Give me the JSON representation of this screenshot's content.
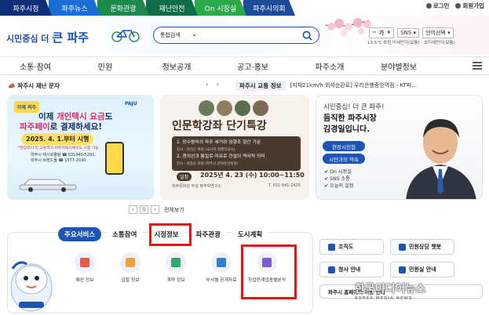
{
  "site_tabs": [
    {
      "label": "파주시청",
      "color": "#0e2f78"
    },
    {
      "label": "파주뉴스",
      "color": "#1a6fd6"
    },
    {
      "label": "문화관광",
      "color": "#1b8a4a"
    },
    {
      "label": "재난안전",
      "color": "#0f6e46"
    },
    {
      "label": "On 시장실",
      "color": "#2aa84a"
    },
    {
      "label": "파주시의회",
      "color": "#1d4b9c"
    }
  ],
  "top_util": {
    "login": "로그인",
    "join": "회원가입"
  },
  "logo": {
    "prefix": "시민중심 더",
    "name": "큰 파주"
  },
  "search": {
    "scope": "통합검색",
    "placeholder": ""
  },
  "util2": {
    "font_label": "가",
    "sns": "SNS",
    "lang": "언어선택"
  },
  "weather": "13.5℃ 흐림 미세먼지(보통) · 초미세먼지(보통)",
  "main_nav": [
    "소통·참여",
    "민원",
    "정보공개",
    "공고·홍보",
    "파주소개",
    "분야별정보"
  ],
  "alert": {
    "title": "파주시 재난 문자",
    "arrows": "‹ ›"
  },
  "traffic": {
    "badge": "파주시 교통 정보",
    "ticker": "[지체21km/h 외석순환로] 우리은행중앙역점 - KT파..."
  },
  "banner1": {
    "logo": "이제 파주",
    "title1_a": "이제 ",
    "title1_b": "개인택시 요금",
    "title1_c": "도",
    "title2_a": "파주페이",
    "title2_b": "로 결제하세요!",
    "date": "2025. 4. 1.부터 시행",
    "note": "*현장택시 및 교통약자 바우처택시에서도 시행 가능",
    "contact1": "파주시 택시화물팀 ☎ 031940-5291,",
    "contact2": "파주시 브랜드몰 ☎ 1577-2030",
    "brand": "PAJU"
  },
  "banner2": {
    "title": "인문학강좌 단기특강",
    "item1": "1. 장수왕비의 파주 세거와 임향조 향간 가문",
    "item1_sub": "강사 : 김선근 위원 (국사학 경제학교사)",
    "item2": "2. 경의선과 통일로·자유로 건설의 역사적 의미",
    "item2_sub": "강사 : 원종순 위원 (파주시 문화유산위원)",
    "date_label": "일정",
    "date": "2025년 4. 23 (수) 10:00~11:50",
    "org": "파주문화원 부설 파주학연구소",
    "tel": "T. 031-941-2425"
  },
  "banner3": {
    "line1": "시민중심! 더 큰 파주!",
    "line2": "듬직한 파주시장",
    "line3": "김경일입니다.",
    "btn1": "현장시진첩",
    "btn2": "시민과의 약속",
    "links": [
      "On 시장실",
      "SNS 소통",
      "오늘의 일정"
    ]
  },
  "pager": {
    "prev": "‹",
    "pause": "||",
    "next": "›",
    "all": "전체보기"
  },
  "service_tabs": [
    "주요서비스",
    "소통참여",
    "시정정보",
    "파주관광",
    "도시계획"
  ],
  "service_items": [
    {
      "label": "예산 정보",
      "icon": "pie-chart-icon",
      "color": "#e8594a"
    },
    {
      "label": "입찰 정보",
      "icon": "gavel-icon",
      "color": "#f0a13a"
    },
    {
      "label": "계약 정보",
      "icon": "contract-icon",
      "color": "#32a86b"
    },
    {
      "label": "부서별 공개자료",
      "icon": "folder-icon",
      "color": "#2f7fd6"
    },
    {
      "label": "창업연계업종별분석",
      "icon": "bar-chart-icon",
      "color": "#7a5bd4"
    }
  ],
  "quick_links": [
    "조직도",
    "민원상담 챗봇",
    "청사 안내",
    "민원실 안내"
  ],
  "quick_wide": "파주시 홈페이지 이용 안내",
  "watermark": {
    "main": "한국미디어뉴스",
    "sub": "KOREA MEDIA NEWS"
  }
}
